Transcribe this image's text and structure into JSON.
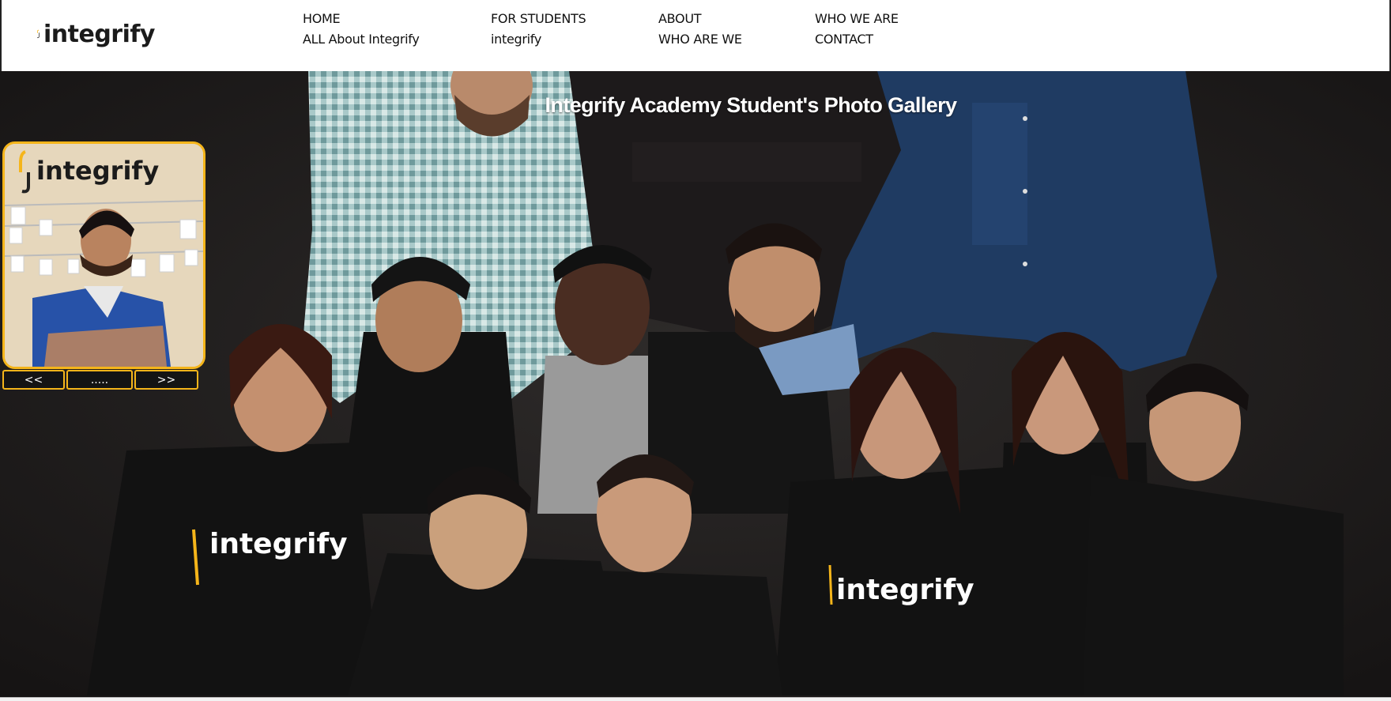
{
  "brand": {
    "logo_text": "integrify",
    "accent": "#f5b51a"
  },
  "nav": {
    "columns": [
      {
        "top": "HOME",
        "bottom": "ALL About Integrify"
      },
      {
        "top": "FOR STUDENTS",
        "bottom": "integrify"
      },
      {
        "top": "ABOUT",
        "bottom": "WHO ARE WE"
      },
      {
        "top": "WHO WE ARE",
        "bottom": "CONTACT"
      }
    ]
  },
  "hero": {
    "title": "Integrify Academy Student's Photo Gallery",
    "shirt_text": "integrify"
  },
  "gallery": {
    "thumb_logo_text": "integrify",
    "prev_label": "<<",
    "dots_label": ".....",
    "next_label": ">>"
  }
}
